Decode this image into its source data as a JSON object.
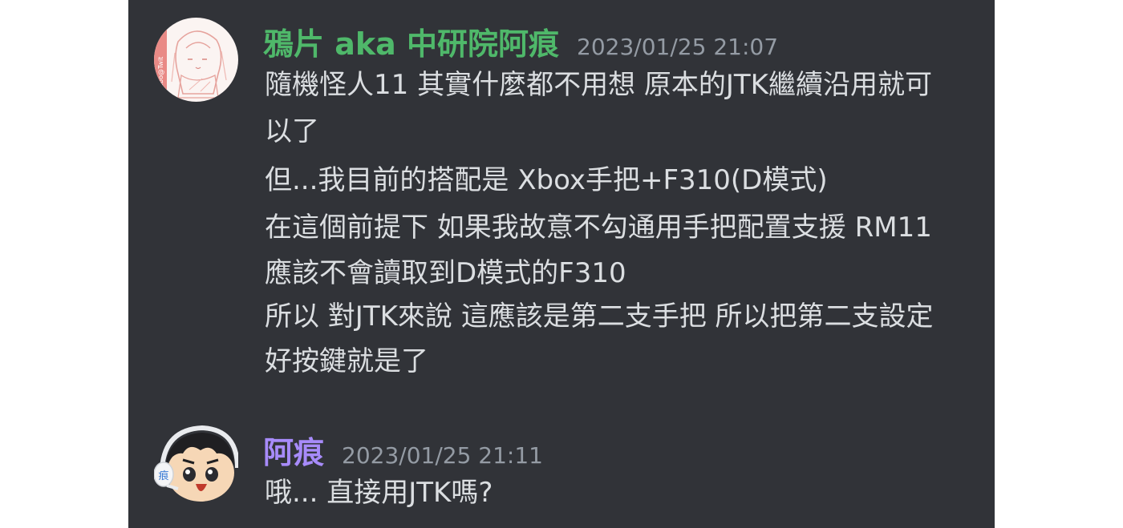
{
  "colors": {
    "panel_bg": "#313338",
    "text": "#dbdee1",
    "timestamp": "#949ba4",
    "user1_name": "#4fb86a",
    "user2_name": "#a78bfa"
  },
  "messages": [
    {
      "username": "鴉片 aka 中研院阿痕",
      "timestamp": "2023/01/25 21:07",
      "avatar": "anime-girl-sketch-avatar",
      "lines": [
        "隨機怪人11 其實什麼都不用想 原本的JTK繼續沿用就可",
        "以了",
        "但...我目前的搭配是 Xbox手把+F310(D模式)",
        "在這個前提下 如果我故意不勾通用手把配置支援 RM11",
        "應該不會讀取到D模式的F310",
        "所以 對JTK來說 這應該是第二支手把 所以把第二支設定",
        "好按鍵就是了"
      ]
    },
    {
      "username": "阿痕",
      "timestamp": "2023/01/25 21:11",
      "avatar": "chibi-headset-avatar",
      "avatar_badge": "痕",
      "lines": [
        "哦... 直接用JTK嗎?"
      ]
    }
  ]
}
